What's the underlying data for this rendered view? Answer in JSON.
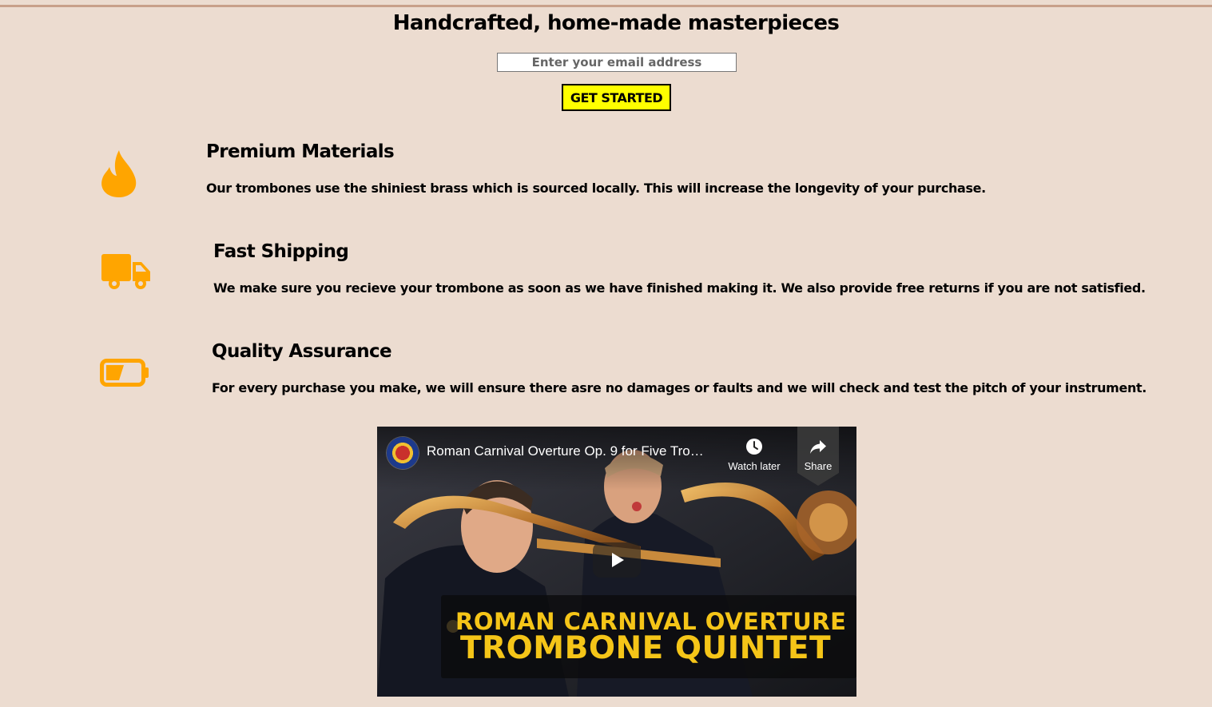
{
  "hero": {
    "title": "Handcrafted, home-made masterpieces",
    "email_placeholder": "Enter your email address",
    "cta_label": "GET STARTED"
  },
  "features": [
    {
      "icon": "fire-icon",
      "title": "Premium Materials",
      "description": "Our trombones use the shiniest brass which is sourced locally. This will increase the longevity of your purchase."
    },
    {
      "icon": "truck-icon",
      "title": "Fast Shipping",
      "description": "We make sure you recieve your trombone as soon as we have finished making it. We also provide free returns if you are not satisfied."
    },
    {
      "icon": "battery-half-icon",
      "title": "Quality Assurance",
      "description": "For every purchase you make, we will ensure there asre no damages or faults and we will check and test the pitch of your instrument."
    }
  ],
  "video": {
    "title": "Roman Carnival Overture Op. 9 for Five Tro…",
    "watch_later_label": "Watch later",
    "share_label": "Share",
    "banner_line_1": "ROMAN CARNIVAL OVERTURE",
    "banner_line_2": "TROMBONE QUINTET"
  },
  "colors": {
    "page_background": "#ecdcd0",
    "accent_icon": "#ffa500",
    "cta_background": "#ffff00",
    "banner_text": "#f5c518"
  }
}
